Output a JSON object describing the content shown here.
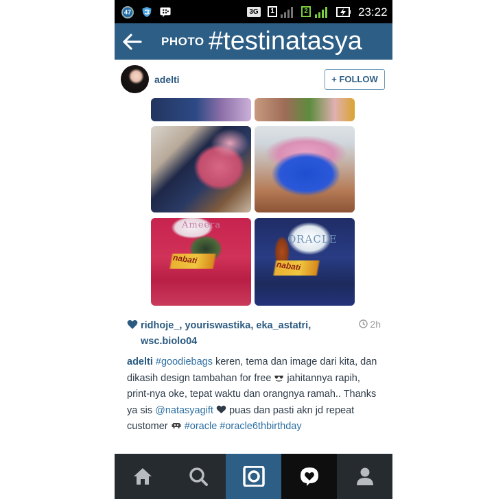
{
  "status_bar": {
    "notification_count": "47",
    "network": "3G",
    "sim1": "1",
    "sim2": "2",
    "time": "23:22"
  },
  "header": {
    "section_label": "PHOTO",
    "hashtag": "#testinatasya"
  },
  "post": {
    "username": "adelti",
    "follow_label": "+ FOLLOW",
    "images": [
      {
        "text": "",
        "brand": ""
      },
      {
        "text": "",
        "brand": ""
      },
      {
        "text": "",
        "brand": ""
      },
      {
        "text": "",
        "brand": ""
      },
      {
        "text": "Ameera",
        "brand": "nabati"
      },
      {
        "text": "ORACLE",
        "brand": "nabati"
      }
    ],
    "likes": "ridhoje_, youriswastika, eka_astatri, wsc.biolo04",
    "time_ago": "2h",
    "caption": {
      "user": "adelti",
      "tag1": "#goodiebags",
      "text1": " keren, tema dan image dari kita, dan dikasih design tambahan for free ",
      "text2": " jahitannya rapih, print-nya oke, tepat waktu dan orangnya ramah.. Thanks ya sis ",
      "mention": "@natasyagift",
      "text3": " puas dan pasti akn jd repeat customer ",
      "tag2": "#oracle",
      "tag3": "#oracle6thbirthday"
    },
    "more_text": "... ...  ..  . ....  ..  ....  ...  .."
  },
  "bottom_nav": {
    "items": [
      "home-icon",
      "search-icon",
      "camera-icon",
      "activity-icon",
      "profile-icon"
    ],
    "active": "camera-icon"
  },
  "colors": {
    "header_bg": "#2d5e85",
    "link_blue": "#2b5a80",
    "nav_bg": "#262b30"
  }
}
